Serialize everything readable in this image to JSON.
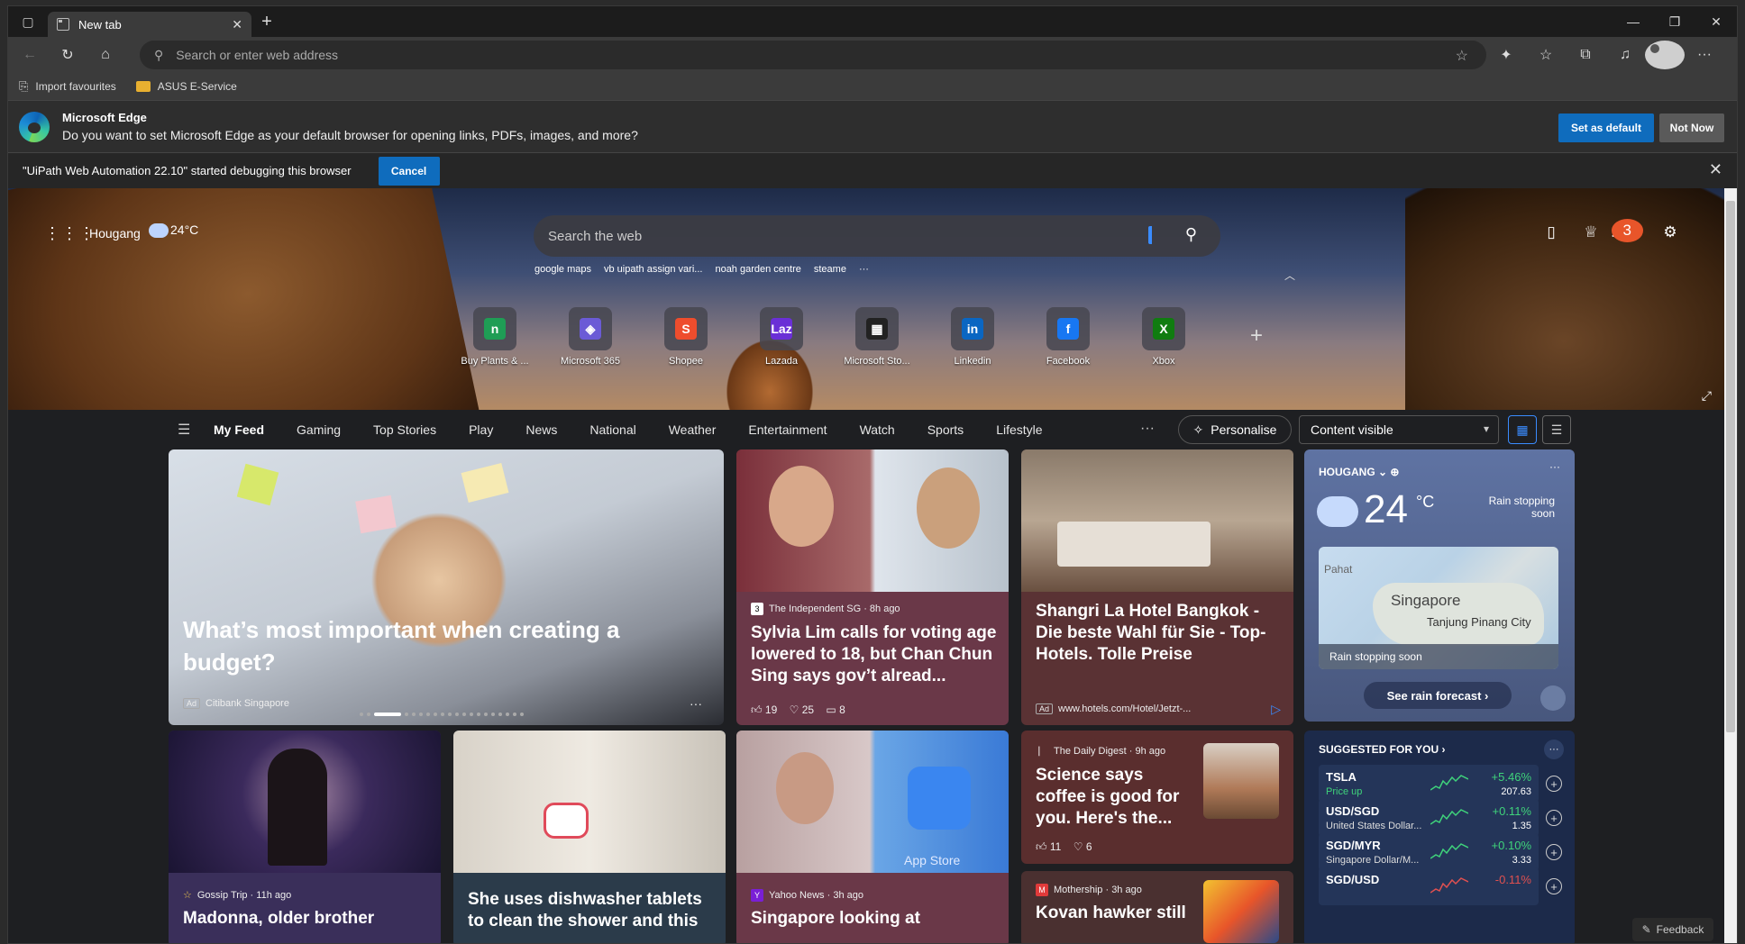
{
  "tab": {
    "title": "New tab"
  },
  "address": {
    "placeholder": "Search or enter web address"
  },
  "favorites": [
    {
      "label": "Import favourites"
    },
    {
      "label": "ASUS E-Service"
    }
  ],
  "default_banner": {
    "title": "Microsoft Edge",
    "message": "Do you want to set Microsoft Edge as your default browser for opening links, PDFs, images, and more?",
    "primary": "Set as default",
    "secondary": "Not Now"
  },
  "debug_banner": {
    "message": "\"UiPath Web Automation 22.10\" started debugging this browser",
    "cancel": "Cancel"
  },
  "hero": {
    "location": "Hougang",
    "temp": "24°C",
    "search_placeholder": "Search the web",
    "suggestions": [
      "google maps",
      "vb uipath assign vari...",
      "noah garden centre",
      "steame"
    ],
    "notification_count": "3",
    "tiles": [
      {
        "name": "Buy Plants & ...",
        "glyph": "n",
        "color": "#1f9d55"
      },
      {
        "name": "Microsoft 365",
        "glyph": "◈",
        "color": "#6b5bd6"
      },
      {
        "name": "Shopee",
        "glyph": "S",
        "color": "#ee4d2d"
      },
      {
        "name": "Lazada",
        "glyph": "Laz",
        "color": "#6a2fd6"
      },
      {
        "name": "Microsoft Sto...",
        "glyph": "▦",
        "color": "#222222"
      },
      {
        "name": "Linkedin",
        "glyph": "in",
        "color": "#0a66c2"
      },
      {
        "name": "Facebook",
        "glyph": "f",
        "color": "#1877f2"
      },
      {
        "name": "Xbox",
        "glyph": "X",
        "color": "#107c10"
      }
    ]
  },
  "feednav": {
    "links": [
      "My Feed",
      "Gaming",
      "Top Stories",
      "Play",
      "News",
      "National",
      "Weather",
      "Entertainment",
      "Watch",
      "Sports",
      "Lifestyle"
    ],
    "more": "···",
    "personalise": "Personalise",
    "content": "Content visible"
  },
  "cards": {
    "c1": {
      "title": "What’s most important when creating a budget?",
      "ad": "Ad",
      "source": "Citibank Singapore",
      "more": "···"
    },
    "c2": {
      "source": "The Independent SG · 8h ago",
      "title": "Sylvia Lim calls for voting age lowered to 18, but Chan Chun Sing says gov’t alread...",
      "likes": "19",
      "dislikes": "25",
      "comments": "8"
    },
    "c3": {
      "title": "Shangri La Hotel Bangkok - Die beste Wahl für Sie - Top-Hotels. Tolle Preise",
      "ad": "Ad",
      "url": "www.hotels.com/Hotel/Jetzt-..."
    },
    "c4": {
      "source": "Gossip Trip · 11h ago",
      "title": "Madonna, older brother"
    },
    "c5": {
      "title": "She uses dishwasher tablets to clean the shower and this"
    },
    "c6": {
      "source": "Yahoo News · 3h ago",
      "title": "Singapore looking at",
      "store": "App Store"
    },
    "c7": {
      "source": "The Daily Digest · 9h ago",
      "title": "Science says coffee is good for you. Here's the...",
      "likes": "11",
      "dislikes": "6"
    },
    "c8": {
      "source": "Mothership · 3h ago",
      "title": "Kovan hawker still"
    }
  },
  "weather": {
    "location": "HOUGANG",
    "temp": "24",
    "unit": "°C",
    "condition": "Rain stopping soon",
    "map_city": "Singapore",
    "map_sub": "Tanjung Pinang City",
    "map_place": "Pahat",
    "map_bar": "Rain stopping soon",
    "button": "See rain forecast"
  },
  "stocks": {
    "header": "SUGGESTED FOR YOU",
    "rows": [
      {
        "symbol": "TSLA",
        "name": "Price up",
        "change": "+5.46%",
        "price": "207.63"
      },
      {
        "symbol": "USD/SGD",
        "name": "United States Dollar...",
        "change": "+0.11%",
        "price": "1.35"
      },
      {
        "symbol": "SGD/MYR",
        "name": "Singapore Dollar/M...",
        "change": "+0.10%",
        "price": "3.33"
      },
      {
        "symbol": "SGD/USD",
        "name": "",
        "change": "-0.11%",
        "price": ""
      }
    ]
  },
  "feedback": "Feedback"
}
